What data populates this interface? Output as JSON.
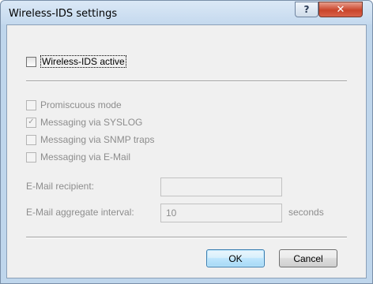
{
  "window": {
    "title": "Wireless-IDS settings",
    "help_glyph": "?",
    "close_glyph": "✕"
  },
  "main_toggle": {
    "label": "Wireless-IDS active",
    "checked": false
  },
  "options": [
    {
      "label": "Promiscuous mode",
      "checked": false
    },
    {
      "label": "Messaging via SYSLOG",
      "checked": true
    },
    {
      "label": "Messaging via SNMP traps",
      "checked": false
    },
    {
      "label": "Messaging via E-Mail",
      "checked": false
    }
  ],
  "fields": {
    "recipient_label": "E-Mail recipient:",
    "recipient_value": "",
    "interval_label": "E-Mail aggregate interval:",
    "interval_value": "10",
    "interval_unit": "seconds"
  },
  "buttons": {
    "ok": "OK",
    "cancel": "Cancel"
  },
  "colors": {
    "disabled_text": "#8d8d8d",
    "close_button": "#c9452b",
    "default_button_border": "#3c7fb1"
  }
}
